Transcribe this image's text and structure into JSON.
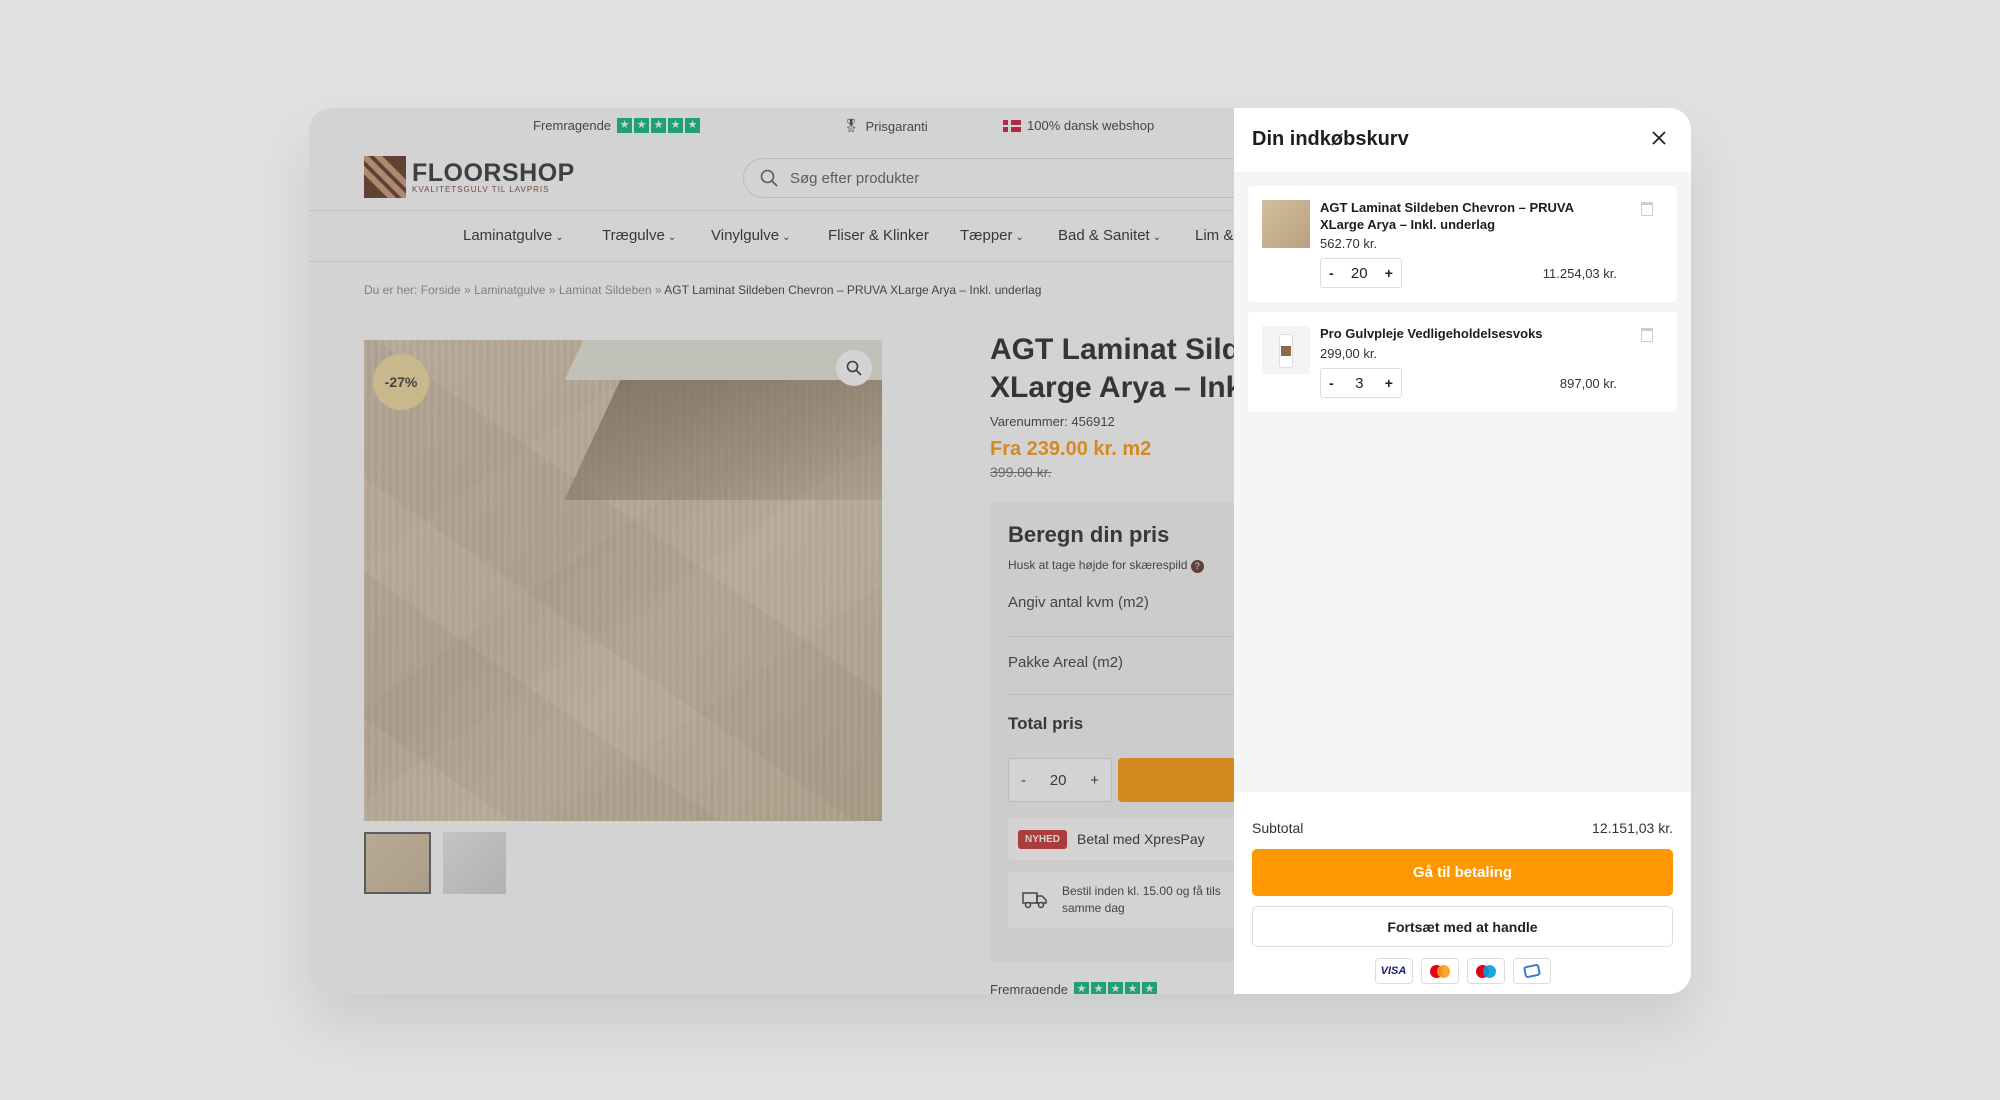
{
  "topbar": {
    "rating_label": "Fremragende",
    "price_guarantee": "Prisgaranti",
    "danish_shop": "100% dansk webshop"
  },
  "header": {
    "logo_title": "FLOORSHOP",
    "logo_sub": "KVALITETSGULV TIL LAVPRIS",
    "search_placeholder": "Søg efter produkter"
  },
  "nav": {
    "items": [
      {
        "label": "Laminatgulve"
      },
      {
        "label": "Trægulve"
      },
      {
        "label": "Vinylgulve"
      },
      {
        "label": "Fliser & Klinker"
      },
      {
        "label": "Tæpper"
      },
      {
        "label": "Bad & Sanitet"
      },
      {
        "label": "Lim &"
      }
    ]
  },
  "breadcrumb": {
    "prefix": "Du er her:",
    "home": "Forside",
    "cat": "Laminatgulve",
    "sub": "Laminat Sildeben",
    "current": "AGT Laminat Sildeben Chevron – PRUVA XLarge Arya – Inkl. underlag",
    "sep": "»"
  },
  "product": {
    "badge": "-27%",
    "title_line1": "AGT Laminat Silde",
    "title_line2": "XLarge Arya – Ink",
    "sku": "Varenummer: 456912",
    "price": "Fra 239.00 kr. m2",
    "old_price": "399.00 kr."
  },
  "calc": {
    "heading": "Beregn din pris",
    "sub": "Husk at tage højde for skærespild",
    "row1": "Angiv antal kvm (m2)",
    "row2": "Pakke Areal (m2)",
    "total": "Total pris",
    "qty": "20",
    "minus": "-",
    "plus": "+",
    "nyhed": "NYHED",
    "xpres": "Betal med XpresPay",
    "delivery_line1": "Bestil inden kl. 15.00 og få tils",
    "delivery_line2": "samme dag"
  },
  "bottom_rating": "Fremragende",
  "cart": {
    "title": "Din indkøbskurv",
    "items": [
      {
        "name": "AGT Laminat Sildeben Chevron – PRUVA XLarge Arya – Inkl. underlag",
        "unit_price": "562.70 kr.",
        "qty": "20",
        "total": "11.254,03 kr."
      },
      {
        "name": "Pro Gulvpleje Vedligeholdelsesvoks",
        "unit_price": "299,00 kr.",
        "qty": "3",
        "total": "897,00 kr."
      }
    ],
    "minus": "-",
    "plus": "+",
    "subtotal_label": "Subtotal",
    "subtotal_value": "12.151,03 kr.",
    "checkout_label": "Gå til betaling",
    "continue_label": "Fortsæt med at handle",
    "payment_visa": "VISA"
  },
  "colors": {
    "accent": "#ff9800",
    "trustpilot": "#00b67a",
    "badge": "#f3d99b",
    "nyhed": "#c62828"
  }
}
